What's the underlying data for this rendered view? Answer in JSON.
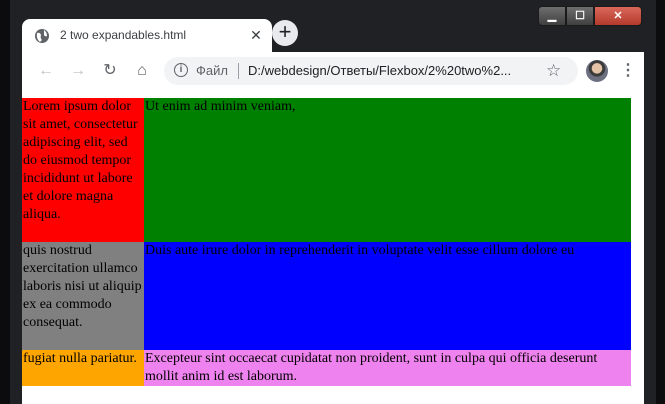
{
  "tab": {
    "title": "2 two expandables.html",
    "close_glyph": "✕"
  },
  "newtab_glyph": "+",
  "window_controls": {
    "minimize": "▁",
    "maximize": "☐",
    "close": "✕"
  },
  "toolbar": {
    "back_glyph": "←",
    "forward_glyph": "→",
    "reload_glyph": "↻",
    "home_glyph": "⌂",
    "info_glyph": "i",
    "scheme_label": "Файл",
    "url": "D:/webdesign/Ответы/Flexbox/2%20two%2...",
    "star_glyph": "☆",
    "menu_glyph": "⋮"
  },
  "content": {
    "cells": [
      {
        "text": "Lorem ipsum dolor sit amet, consectetur adipiscing elit, sed do eiusmod tempor incididunt ut labore et dolore magna aliqua.",
        "color": "#ff0000"
      },
      {
        "text": "Ut enim ad minim veniam,",
        "color": "#008000"
      },
      {
        "text": "quis nostrud exercitation ullamco laboris nisi ut aliquip ex ea commodo consequat.",
        "color": "#808080"
      },
      {
        "text": "Duis aute irure dolor in reprehenderit in voluptate velit esse cillum dolore eu",
        "color": "#0000ff"
      },
      {
        "text": "fugiat nulla pariatur.",
        "color": "#ffa500"
      },
      {
        "text": "Excepteur sint occaecat cupidatat non proident, sunt in culpa qui officia deserunt mollit anim id est laborum.",
        "color": "#ee82ee"
      }
    ]
  }
}
